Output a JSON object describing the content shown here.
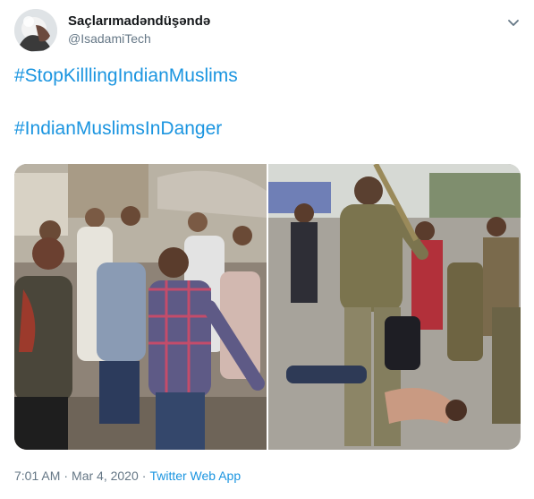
{
  "tweet": {
    "author_name": "Saçlarımadəndüşəndə",
    "author_handle": "@IsadamiTech",
    "hashtags": [
      "#StopKilllingIndianMuslims",
      "#IndianMuslimsInDanger"
    ],
    "time": "7:01 AM",
    "separator": "·",
    "date": "Mar 4, 2020",
    "source": "Twitter Web App"
  },
  "colors": {
    "link": "#1b95e0",
    "secondary_text": "#657786",
    "primary_text": "#14171a"
  },
  "icons": {
    "menu": "chevron-down-icon"
  }
}
